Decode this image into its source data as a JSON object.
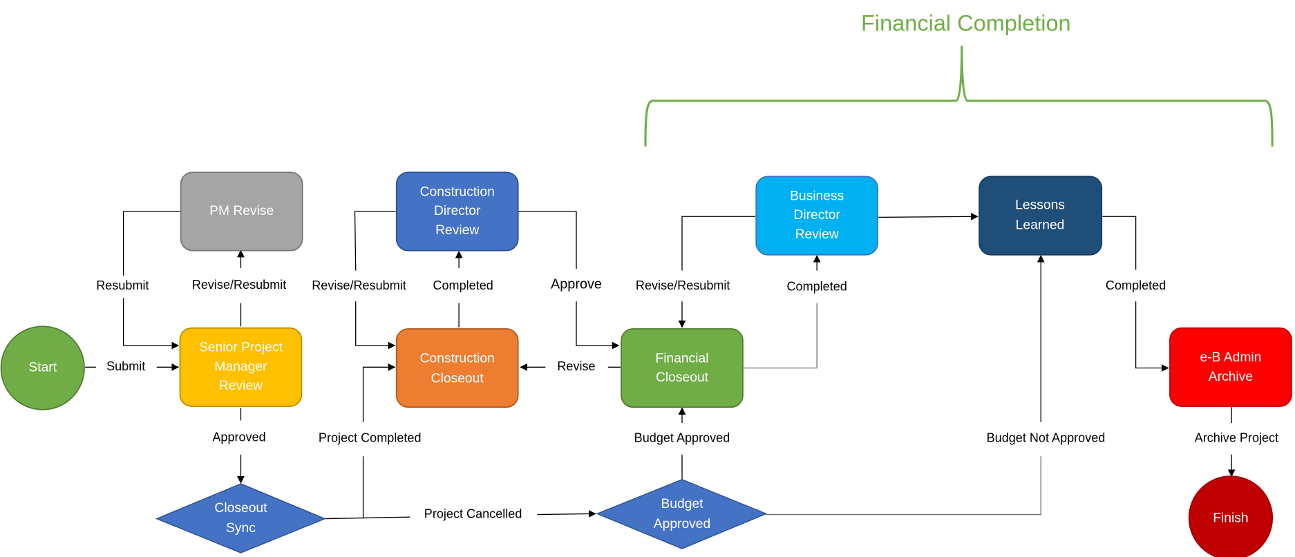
{
  "diagram": {
    "type": "flowchart",
    "group_label": {
      "text": "Financial Completion",
      "color": "#70AD47"
    },
    "nodes": [
      {
        "id": "start",
        "shape": "circle",
        "label": "Start",
        "fill": "#70AD47",
        "stroke": "#507E32"
      },
      {
        "id": "spm",
        "shape": "rounded-rect",
        "label": [
          "Senior Project",
          "Manager",
          "Review"
        ],
        "fill": "#FFC000",
        "stroke": "#BC8C00"
      },
      {
        "id": "pm_revise",
        "shape": "rounded-rect",
        "label": [
          "PM Revise"
        ],
        "fill": "#A5A5A5",
        "stroke": "#787878"
      },
      {
        "id": "closeout_sync",
        "shape": "diamond",
        "label": [
          "Closeout",
          "Sync"
        ],
        "fill": "#4472C4",
        "stroke": "#2F528F"
      },
      {
        "id": "cdr",
        "shape": "rounded-rect",
        "label": [
          "Construction",
          "Director",
          "Review"
        ],
        "fill": "#4472C4",
        "stroke": "#2F528F"
      },
      {
        "id": "cc",
        "shape": "rounded-rect",
        "label": [
          "Construction",
          "Closeout"
        ],
        "fill": "#ED7D31",
        "stroke": "#AE5A21"
      },
      {
        "id": "fc",
        "shape": "rounded-rect",
        "label": [
          "Financial",
          "Closeout"
        ],
        "fill": "#70AD47",
        "stroke": "#507E32"
      },
      {
        "id": "budget",
        "shape": "diamond",
        "label": [
          "Budget",
          "Approved"
        ],
        "fill": "#4472C4",
        "stroke": "#2F528F"
      },
      {
        "id": "bdr",
        "shape": "rounded-rect",
        "label": [
          "Business",
          "Director",
          "Review"
        ],
        "fill": "#00B0F0",
        "stroke": "#4472C4"
      },
      {
        "id": "lessons",
        "shape": "rounded-rect",
        "label": [
          "Lessons",
          "Learned"
        ],
        "fill": "#1F4E79",
        "stroke": "#1A3D5E"
      },
      {
        "id": "archive",
        "shape": "rounded-rect",
        "label": [
          "e-B Admin",
          "Archive"
        ],
        "fill": "#FF0000",
        "stroke": "#C00000"
      },
      {
        "id": "finish",
        "shape": "circle",
        "label": "Finish",
        "fill": "#C00000",
        "stroke": "#A00000"
      }
    ],
    "edges": [
      {
        "from": "start",
        "to": "spm",
        "label": "Submit"
      },
      {
        "from": "spm",
        "to": "pm_revise",
        "label": "Revise/Resubmit"
      },
      {
        "from": "pm_revise",
        "to": "spm",
        "label": "Resubmit"
      },
      {
        "from": "spm",
        "to": "closeout_sync",
        "label": "Approved"
      },
      {
        "from": "closeout_sync",
        "to": "cc",
        "label": "Project Completed"
      },
      {
        "from": "closeout_sync",
        "to": "budget",
        "label": "Project Cancelled"
      },
      {
        "from": "cc",
        "to": "cdr",
        "label": "Completed"
      },
      {
        "from": "cdr",
        "to": "cc",
        "label": "Revise/Resubmit"
      },
      {
        "from": "cdr",
        "to": "fc",
        "label": "Approve"
      },
      {
        "from": "fc",
        "to": "cc",
        "label": "Revise"
      },
      {
        "from": "fc",
        "to": "bdr",
        "label": "Completed"
      },
      {
        "from": "bdr",
        "to": "fc",
        "label": "Revise/Resubmit"
      },
      {
        "from": "budget",
        "to": "fc",
        "label": "Budget Approved"
      },
      {
        "from": "budget",
        "to": "lessons",
        "label": "Budget Not Approved"
      },
      {
        "from": "bdr",
        "to": "lessons",
        "label": ""
      },
      {
        "from": "lessons",
        "to": "archive",
        "label": "Completed"
      },
      {
        "from": "archive",
        "to": "finish",
        "label": "Archive Project"
      }
    ]
  }
}
